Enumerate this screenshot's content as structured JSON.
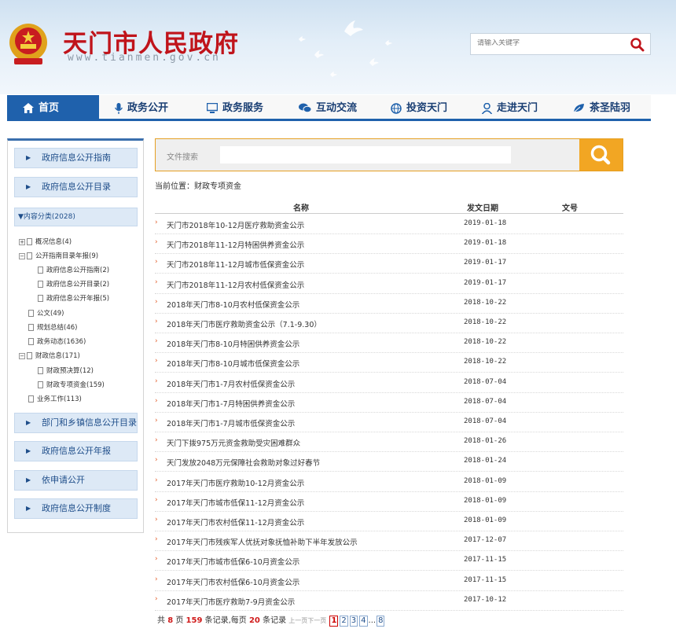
{
  "header": {
    "title": "天门市人民政府",
    "url": "www.tianmen.gov.cn",
    "search_placeholder": "请输入关键字"
  },
  "nav": [
    {
      "label": "首页",
      "icon": "home-icon",
      "active": true
    },
    {
      "label": "政务公开",
      "icon": "microphone-icon"
    },
    {
      "label": "政务服务",
      "icon": "monitor-icon"
    },
    {
      "label": "互动交流",
      "icon": "chat-icon"
    },
    {
      "label": "投资天门",
      "icon": "globe-icon"
    },
    {
      "label": "走进天门",
      "icon": "person-icon"
    },
    {
      "label": "茶圣陆羽",
      "icon": "leaf-icon"
    }
  ],
  "sidebar": {
    "guide": "政府信息公开指南",
    "catalog": "政府信息公开目录",
    "category": "▼内容分类(2028)",
    "tree": [
      "概况信息(4)",
      "公开指南目录年报(9)",
      "政府信息公开指南(2)",
      "政府信息公开目录(2)",
      "政府信息公开年报(5)",
      "公文(49)",
      "规划总结(46)",
      "政务动态(1636)",
      "财政信息(171)",
      "财政预决算(12)",
      "财政专项资金(159)",
      "业务工作(113)"
    ],
    "bottom": [
      "部门和乡镇信息公开目录",
      "政府信息公开年报",
      "依申请公开",
      "政府信息公开制度"
    ]
  },
  "main": {
    "search_label": "文件搜索",
    "breadcrumb": "当前位置：财政专项资金",
    "columns": [
      "名称",
      "发文日期",
      "文号"
    ],
    "rows": [
      {
        "title": "天门市2018年10-12月医疗救助资金公示",
        "date": "2019-01-18"
      },
      {
        "title": "天门市2018年11-12月特困供养资金公示",
        "date": "2019-01-18"
      },
      {
        "title": "天门市2018年11-12月城市低保资金公示",
        "date": "2019-01-17"
      },
      {
        "title": "天门市2018年11-12月农村低保资金公示",
        "date": "2019-01-17"
      },
      {
        "title": "2018年天门市8-10月农村低保资金公示",
        "date": "2018-10-22"
      },
      {
        "title": "2018年天门市医疗救助资金公示（7.1-9.30）",
        "date": "2018-10-22"
      },
      {
        "title": "2018年天门市8-10月特困供养资金公示",
        "date": "2018-10-22"
      },
      {
        "title": "2018年天门市8-10月城市低保资金公示",
        "date": "2018-10-22"
      },
      {
        "title": "2018年天门市1-7月农村低保资金公示",
        "date": "2018-07-04"
      },
      {
        "title": "2018年天门市1-7月特困供养资金公示",
        "date": "2018-07-04"
      },
      {
        "title": "2018年天门市1-7月城市低保资金公示",
        "date": "2018-07-04"
      },
      {
        "title": "天门下拨975万元资金救助受灾困难群众",
        "date": "2018-01-26"
      },
      {
        "title": "天门发放2048万元保障社会救助对象过好春节",
        "date": "2018-01-24"
      },
      {
        "title": "2017年天门市医疗救助10-12月资金公示",
        "date": "2018-01-09"
      },
      {
        "title": "2017年天门市城市低保11-12月资金公示",
        "date": "2018-01-09"
      },
      {
        "title": "2017年天门市农村低保11-12月资金公示",
        "date": "2018-01-09"
      },
      {
        "title": "2017年天门市残疾军人优抚对象抚恤补助下半年发放公示",
        "date": "2017-12-07"
      },
      {
        "title": "2017年天门市城市低保6-10月资金公示",
        "date": "2017-11-15"
      },
      {
        "title": "2017年天门市农村低保6-10月资金公示",
        "date": "2017-11-15"
      },
      {
        "title": "2017年天门市医疗救助7-9月资金公示",
        "date": "2017-10-12"
      }
    ]
  },
  "pager": {
    "prefix": "共",
    "pages": "8",
    "pages_unit": "页",
    "records": "159",
    "records_unit": "条记录,每页",
    "per_page": "20",
    "per_unit": "条记录",
    "prev": "上一页",
    "next": "下一页",
    "numbers": [
      "1",
      "2",
      "3",
      "4"
    ],
    "ellipsis": "...",
    "last": "8"
  },
  "colors": {
    "primary": "#1f61ac",
    "accent": "#f2a623",
    "red": "#c0141b"
  }
}
